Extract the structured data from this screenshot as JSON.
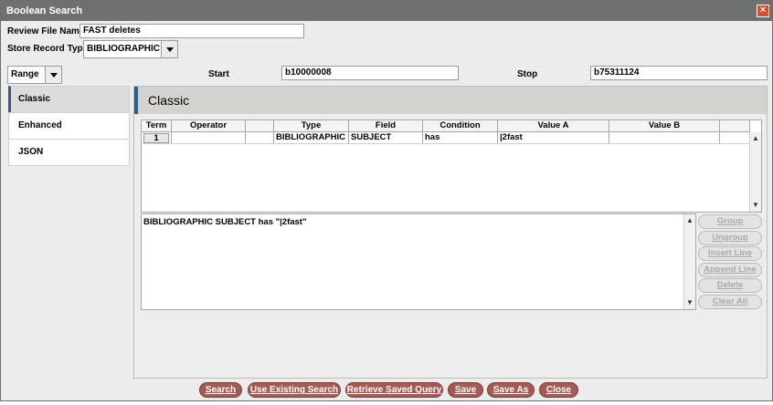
{
  "window": {
    "title": "Boolean Search",
    "close_glyph": "×"
  },
  "form": {
    "review_file_label": "Review File Name:",
    "review_file_value": "FAST deletes",
    "record_type_label": "Store Record Type:",
    "record_type_value": "BIBLIOGRAPHIC  b",
    "range_value": "Range",
    "start_label": "Start",
    "start_value": "b10000008",
    "stop_label": "Stop",
    "stop_value": "b75311124"
  },
  "nav": {
    "items": [
      {
        "label": "Classic",
        "active": true
      },
      {
        "label": "Enhanced",
        "active": false
      },
      {
        "label": "JSON",
        "active": false
      }
    ]
  },
  "panel": {
    "title": "Classic"
  },
  "grid": {
    "headers": [
      "Term",
      "Operator",
      "",
      "Type",
      "Field",
      "Condition",
      "Value A",
      "Value B",
      ""
    ],
    "rows": [
      {
        "term": "1",
        "operator": "",
        "blank": "",
        "type": "BIBLIOGRAPHIC",
        "field": "SUBJECT",
        "condition": "has",
        "value_a": "|2fast",
        "value_b": "",
        "extra": ""
      }
    ]
  },
  "query": {
    "text": "BIBLIOGRAPHIC  SUBJECT  has  \"|2fast\""
  },
  "side_buttons": {
    "group": "Group",
    "ungroup": "Ungroup",
    "insert_line": "Insert Line",
    "append_line": "Append Line",
    "delete": "Delete",
    "clear_all": "Clear All"
  },
  "bottom_buttons": {
    "search": "Search",
    "use_existing": "Use Existing Search",
    "retrieve": "Retrieve Saved Query",
    "save": "Save",
    "save_as": "Save As",
    "close": "Close"
  },
  "colors": {
    "title_bar": "#6f7171",
    "accent": "#2b5f8c",
    "button": "#a65a55",
    "close_button": "#d8502b"
  },
  "icons": {
    "close": "close-icon",
    "dropdown": "chevron-down-icon",
    "scroll_up": "chevron-up-icon",
    "scroll_down": "chevron-down-icon"
  }
}
